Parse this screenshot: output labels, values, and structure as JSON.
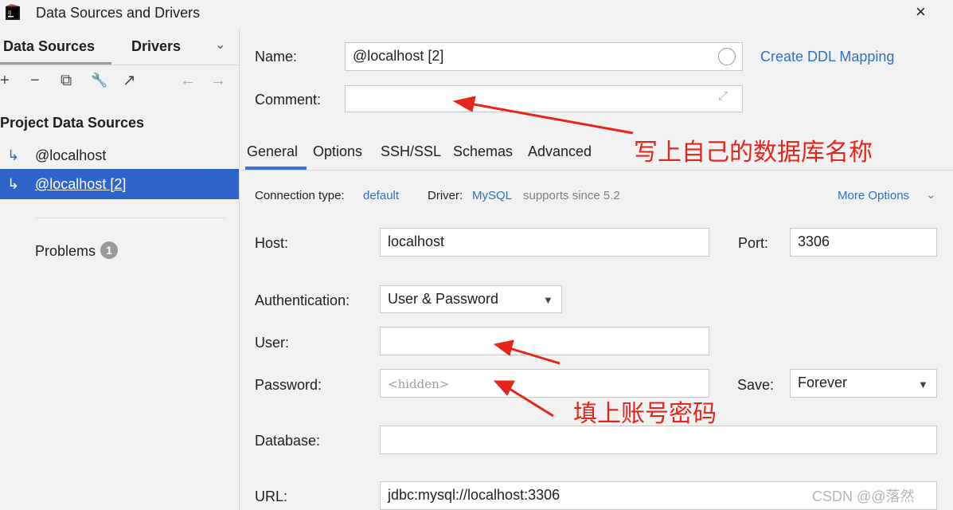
{
  "window": {
    "title": "Data Sources and Drivers",
    "close_label": "×"
  },
  "sidebar": {
    "tabs": [
      "Data Sources",
      "Drivers"
    ],
    "toolbar": [
      "+",
      "−",
      "⧉",
      "🔧",
      "↗",
      "←",
      "→"
    ],
    "section_title": "Project Data Sources",
    "items": [
      {
        "label": "@localhost",
        "icon": "mysql-dolphin-icon",
        "selected": false
      },
      {
        "label": "@localhost [2]",
        "icon": "mysql-dolphin-icon",
        "selected": true
      }
    ],
    "problems": {
      "label": "Problems",
      "count": "1"
    }
  },
  "form": {
    "name_label": "Name:",
    "name_value": "@localhost [2]",
    "create_ddl": "Create DDL Mapping",
    "comment_label": "Comment:",
    "comment_value": ""
  },
  "tabs": [
    "General",
    "Options",
    "SSH/SSL",
    "Schemas",
    "Advanced"
  ],
  "connection": {
    "type_label": "Connection type:",
    "type_value": "default",
    "driver_label": "Driver:",
    "driver_value": "MySQL",
    "driver_note": "supports since 5.2",
    "more_options": "More Options"
  },
  "fields": {
    "host_label": "Host:",
    "host_value": "localhost",
    "port_label": "Port:",
    "port_value": "3306",
    "auth_label": "Authentication:",
    "auth_value": "User & Password",
    "user_label": "User:",
    "user_value": "",
    "password_label": "Password:",
    "password_placeholder": "<hidden>",
    "save_label": "Save:",
    "save_value": "Forever",
    "database_label": "Database:",
    "database_value": "",
    "url_label": "URL:",
    "url_value": "jdbc:mysql://localhost:3306"
  },
  "annotations": {
    "comment_note": "写上自己的数据库名称",
    "credentials_note": "填上账号密码",
    "color": "#e8251b"
  },
  "watermark": "CSDN @@落然"
}
